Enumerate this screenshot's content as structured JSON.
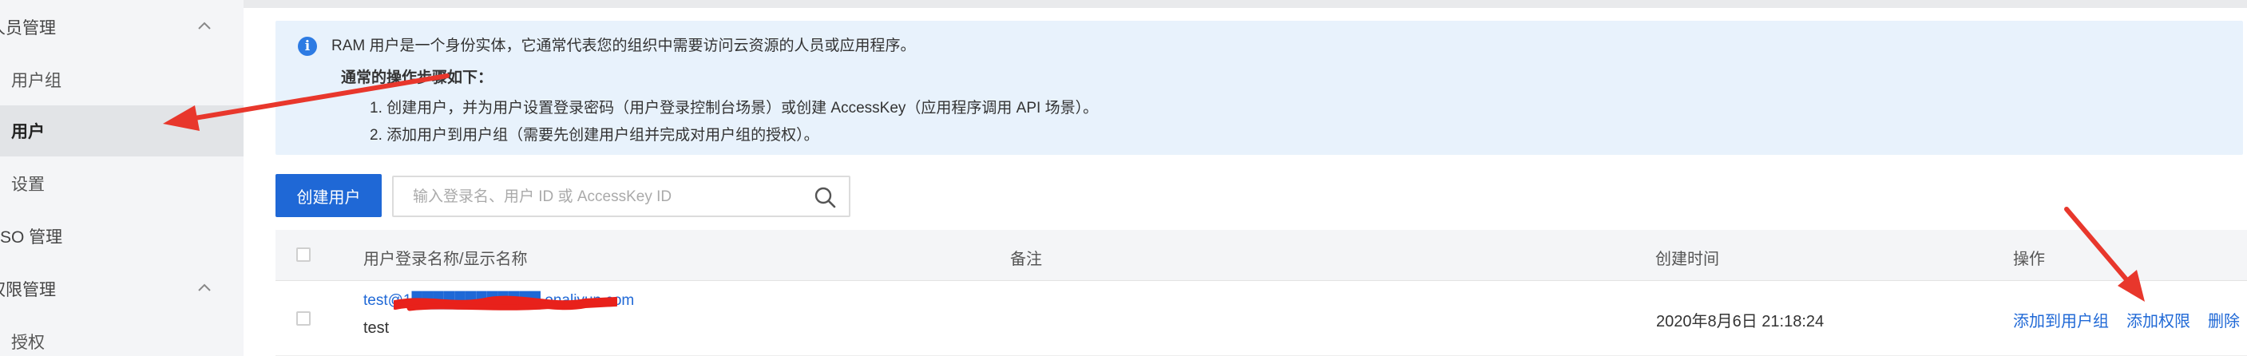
{
  "sidebar": {
    "groups": [
      {
        "label": "人员管理"
      },
      {
        "label": "权限管理"
      }
    ],
    "items": [
      {
        "label": "用户组"
      },
      {
        "label": "用户"
      },
      {
        "label": "设置"
      },
      {
        "label": "SSO 管理"
      },
      {
        "label": "授权"
      }
    ]
  },
  "notice": {
    "intro": "RAM 用户是一个身份实体，它通常代表您的组织中需要访问云资源的人员或应用程序。",
    "steps_title": "通常的操作步骤如下：",
    "steps": [
      "1. 创建用户，并为用户设置登录密码（用户登录控制台场景）或创建 AccessKey（应用程序调用 API 场景）。",
      "2. 添加用户到用户组（需要先创建用户组并完成对用户组的授权）。"
    ]
  },
  "toolbar": {
    "create_label": "创建用户",
    "search_placeholder": "输入登录名、用户 ID 或 AccessKey ID"
  },
  "table": {
    "columns": [
      "用户登录名称/显示名称",
      "备注",
      "创建时间",
      "操作"
    ],
    "rows": [
      {
        "login_name": "test@1████████████.onaliyun.com",
        "display_name": "test",
        "remark": "",
        "created": "2020年8月6日 21:18:24",
        "actions": [
          "添加到用户组",
          "添加权限",
          "删除"
        ]
      }
    ]
  },
  "colors": {
    "primary": "#1f68d6",
    "notice_bg": "#e8f2fc",
    "annotation": "#e8372c",
    "redaction": "#e8211b"
  }
}
